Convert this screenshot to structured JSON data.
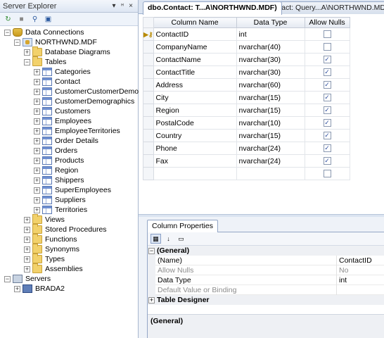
{
  "server_explorer": {
    "title": "Server Explorer",
    "pin_glyph": "▾ ᵸ ×",
    "toolbar": [
      {
        "name": "refresh-icon",
        "glyph": "↻"
      },
      {
        "name": "stop-refresh-icon",
        "glyph": "■"
      },
      {
        "name": "connect-database-icon",
        "glyph": "⚲"
      },
      {
        "name": "connect-server-icon",
        "glyph": "▣"
      }
    ],
    "tree": [
      {
        "label": "Data Connections",
        "depth": 0,
        "exp": "−",
        "icon": "db"
      },
      {
        "label": "NORTHWND.MDF",
        "depth": 1,
        "exp": "−",
        "icon": "dbfile"
      },
      {
        "label": "Database Diagrams",
        "depth": 2,
        "exp": "+",
        "icon": "folder"
      },
      {
        "label": "Tables",
        "depth": 2,
        "exp": "−",
        "icon": "folder"
      },
      {
        "label": "Categories",
        "depth": 3,
        "exp": "+",
        "icon": "table"
      },
      {
        "label": "Contact",
        "depth": 3,
        "exp": "+",
        "icon": "table"
      },
      {
        "label": "CustomerCustomerDemo",
        "depth": 3,
        "exp": "+",
        "icon": "table"
      },
      {
        "label": "CustomerDemographics",
        "depth": 3,
        "exp": "+",
        "icon": "table"
      },
      {
        "label": "Customers",
        "depth": 3,
        "exp": "+",
        "icon": "table"
      },
      {
        "label": "Employees",
        "depth": 3,
        "exp": "+",
        "icon": "table"
      },
      {
        "label": "EmployeeTerritories",
        "depth": 3,
        "exp": "+",
        "icon": "table"
      },
      {
        "label": "Order Details",
        "depth": 3,
        "exp": "+",
        "icon": "table"
      },
      {
        "label": "Orders",
        "depth": 3,
        "exp": "+",
        "icon": "table"
      },
      {
        "label": "Products",
        "depth": 3,
        "exp": "+",
        "icon": "table"
      },
      {
        "label": "Region",
        "depth": 3,
        "exp": "+",
        "icon": "table"
      },
      {
        "label": "Shippers",
        "depth": 3,
        "exp": "+",
        "icon": "table"
      },
      {
        "label": "SuperEmployees",
        "depth": 3,
        "exp": "+",
        "icon": "table"
      },
      {
        "label": "Suppliers",
        "depth": 3,
        "exp": "+",
        "icon": "table"
      },
      {
        "label": "Territories",
        "depth": 3,
        "exp": "+",
        "icon": "table"
      },
      {
        "label": "Views",
        "depth": 2,
        "exp": "+",
        "icon": "folder"
      },
      {
        "label": "Stored Procedures",
        "depth": 2,
        "exp": "+",
        "icon": "folder"
      },
      {
        "label": "Functions",
        "depth": 2,
        "exp": "+",
        "icon": "folder"
      },
      {
        "label": "Synonyms",
        "depth": 2,
        "exp": "+",
        "icon": "folder"
      },
      {
        "label": "Types",
        "depth": 2,
        "exp": "+",
        "icon": "folder"
      },
      {
        "label": "Assemblies",
        "depth": 2,
        "exp": "+",
        "icon": "folder"
      },
      {
        "label": "Servers",
        "depth": 0,
        "exp": "−",
        "icon": "servers"
      },
      {
        "label": "BRADA2",
        "depth": 1,
        "exp": "+",
        "icon": "computer"
      }
    ]
  },
  "tabs": {
    "active": "dbo.Contact: T...A\\NORTHWND.MDF)",
    "inactive": "Contact: Query...A\\NORTHWND.MDF)"
  },
  "grid": {
    "headers": {
      "name": "Column Name",
      "type": "Data Type",
      "nulls": "Allow Nulls"
    },
    "key_glyph": "▶⚷",
    "rows": [
      {
        "name": "ContactID",
        "type": "int",
        "allow_nulls": false,
        "key": true
      },
      {
        "name": "CompanyName",
        "type": "nvarchar(40)",
        "allow_nulls": false
      },
      {
        "name": "ContactName",
        "type": "nvarchar(30)",
        "allow_nulls": true
      },
      {
        "name": "ContactTitle",
        "type": "nvarchar(30)",
        "allow_nulls": true
      },
      {
        "name": "Address",
        "type": "nvarchar(60)",
        "allow_nulls": true
      },
      {
        "name": "City",
        "type": "nvarchar(15)",
        "allow_nulls": true
      },
      {
        "name": "Region",
        "type": "nvarchar(15)",
        "allow_nulls": true
      },
      {
        "name": "PostalCode",
        "type": "nvarchar(10)",
        "allow_nulls": true
      },
      {
        "name": "Country",
        "type": "nvarchar(15)",
        "allow_nulls": true
      },
      {
        "name": "Phone",
        "type": "nvarchar(24)",
        "allow_nulls": true
      },
      {
        "name": "Fax",
        "type": "nvarchar(24)",
        "allow_nulls": true
      },
      {
        "name": "",
        "type": "",
        "allow_nulls": false
      }
    ]
  },
  "properties": {
    "tab_label": "Column Properties",
    "toolbar": [
      {
        "name": "categorized-icon",
        "glyph": "▦",
        "on": true
      },
      {
        "name": "alphabetical-icon",
        "glyph": "↓",
        "on": false
      },
      {
        "name": "property-pages-icon",
        "glyph": "▭",
        "on": false
      }
    ],
    "general_label": "(General)",
    "items": [
      {
        "name": "(Name)",
        "value": "ContactID",
        "grey": false
      },
      {
        "name": "Allow Nulls",
        "value": "No",
        "grey": true
      },
      {
        "name": "Data Type",
        "value": "int",
        "grey": false
      },
      {
        "name": "Default Value or Binding",
        "value": "",
        "grey": true
      }
    ],
    "table_designer_label": "Table Designer",
    "description_title": "(General)"
  }
}
